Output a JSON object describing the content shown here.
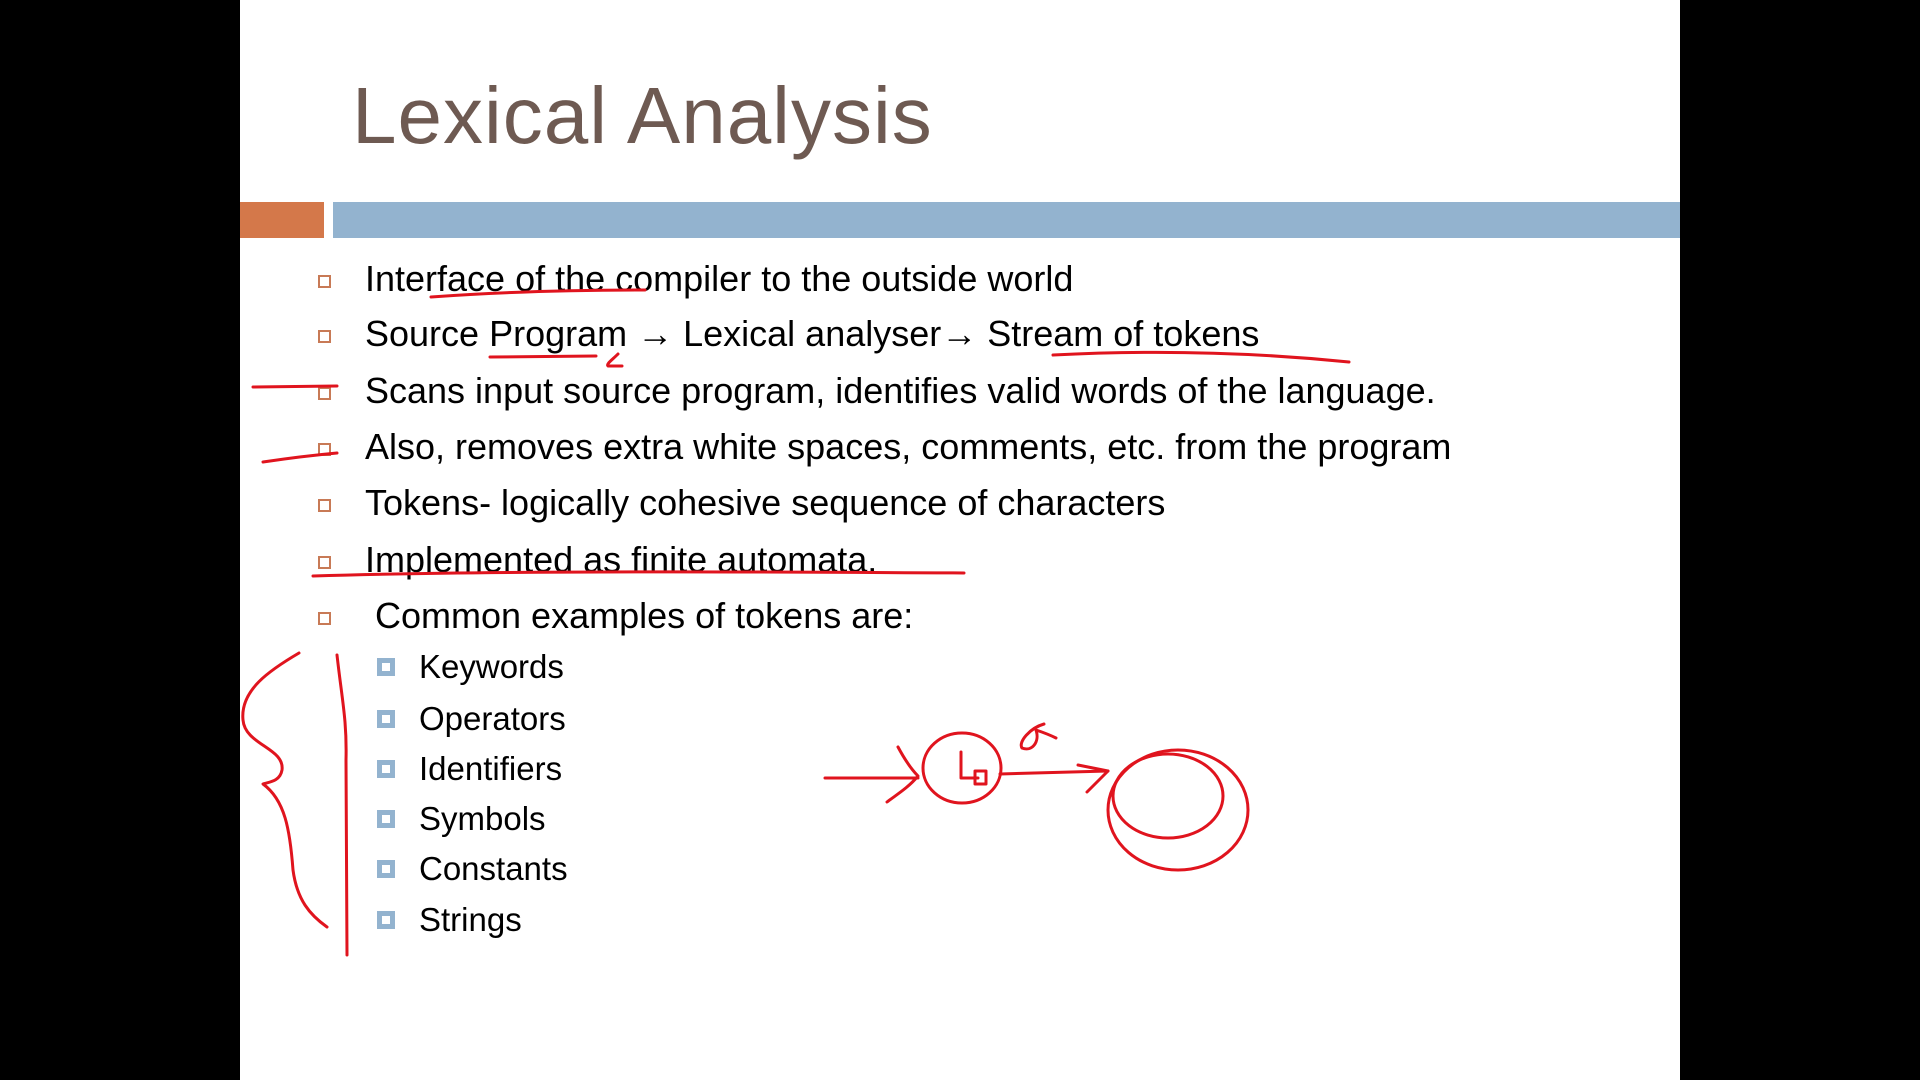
{
  "slide": {
    "title": "Lexical Analysis",
    "colors": {
      "title": "#6e5a52",
      "accent_orange": "#d4784a",
      "accent_blue": "#93b3cf",
      "annotation": "#e0141e"
    },
    "bullets": [
      "Interface of the compiler to the outside world",
      "Source Program → Lexical analyser→ Stream of tokens",
      "Scans input source program, identifies valid words of the language.",
      "Also, removes extra white spaces, comments, etc. from the program",
      "Tokens- logically cohesive sequence of characters",
      "Implemented as finite automata.",
      " Common examples of tokens are:"
    ],
    "sub_bullets": [
      "Keywords",
      "Operators",
      "Identifiers",
      "Symbols",
      "Constants",
      "Strings"
    ]
  }
}
